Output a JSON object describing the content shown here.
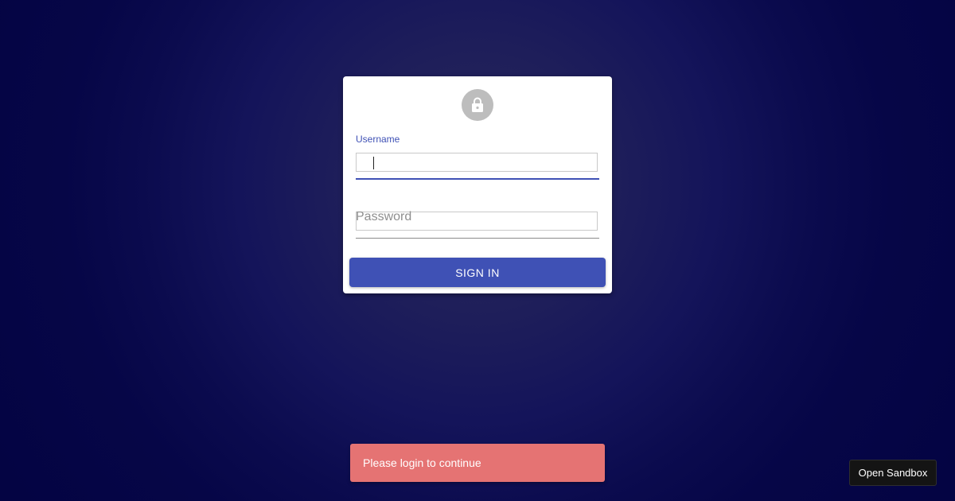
{
  "login_form": {
    "lock_icon": "lock-icon",
    "username": {
      "label": "Username",
      "value": ""
    },
    "password": {
      "placeholder": "Password",
      "value": ""
    },
    "submit_label": "SIGN IN"
  },
  "notification": {
    "message": "Please login to continue",
    "color": "#e57373"
  },
  "sandbox": {
    "label": "Open Sandbox"
  },
  "colors": {
    "primary": "#3f51b5",
    "background": "#060647",
    "avatar": "#bdbdbd"
  }
}
